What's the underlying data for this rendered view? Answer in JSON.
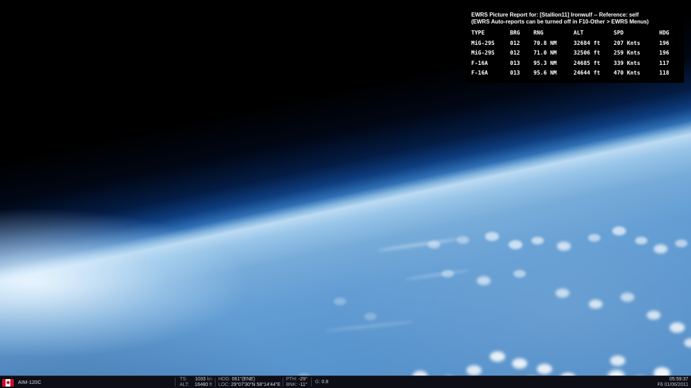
{
  "ewrs_panel": {
    "title_line1": "EWRS Picture Report for: [Stallion11] Ironwulf -- Reference: self",
    "title_line2": "(EWRS Auto-reports can be turned off in F10-Other > EWRS Menus)",
    "columns": [
      "TYPE",
      "BRG",
      "RNG",
      "ALT",
      "SPD",
      "HDG"
    ],
    "rows": [
      {
        "type": "MiG-29S",
        "brg": "012",
        "rng": "70.8 NM",
        "alt": "32684 ft",
        "spd": "207 Knts",
        "hdg": "196"
      },
      {
        "type": "MiG-29S",
        "brg": "012",
        "rng": "71.0 NM",
        "alt": "32506 ft",
        "spd": "259 Knts",
        "hdg": "196"
      },
      {
        "type": "F-16A",
        "brg": "013",
        "rng": "95.3 NM",
        "alt": "24685 ft",
        "spd": "339 Knts",
        "hdg": "117"
      },
      {
        "type": "F-16A",
        "brg": "013",
        "rng": "95.6 NM",
        "alt": "24644 ft",
        "spd": "470 Knts",
        "hdg": "118"
      }
    ]
  },
  "status_bar": {
    "weapon": "AIM-120C",
    "tas_label": "TS:",
    "tas_value": "1033",
    "tas_unit": "kn",
    "alt_label": "ALT:",
    "alt_value": "16480",
    "alt_unit": "ft",
    "hdg_label": "HDG:",
    "hdg_value": "061°(ENE)",
    "loc_label": "LOC:",
    "loc_value": "29°07'30\"N 58°14'44\"E",
    "pth_label": "PTH:",
    "pth_value": "-29°",
    "bnk_label": "BNK:",
    "bnk_value": "-11°",
    "g_label": "G:",
    "g_value": "0.8",
    "time": "05:59:37",
    "date": "F6 01/06/2011"
  },
  "colors": {
    "panel_bg": "#000000",
    "panel_text": "#ffffff",
    "bar_bg": "#0d0e16",
    "bar_text": "#c3c8d2",
    "ocean_blue": "#5f9bd2",
    "horizon_light": "#bcdaf2",
    "space_black": "#000000"
  }
}
